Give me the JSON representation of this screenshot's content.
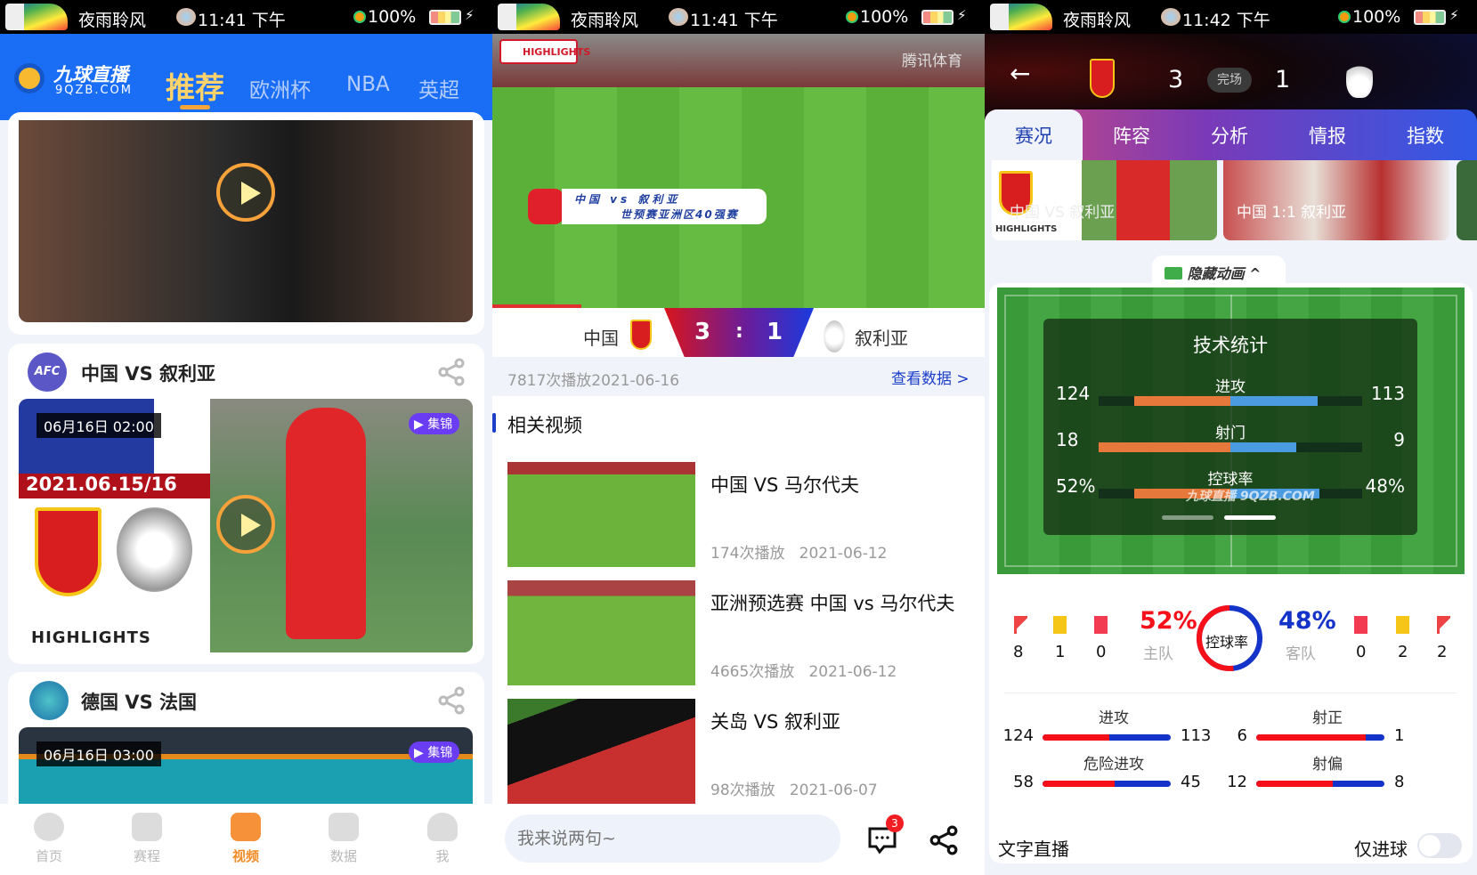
{
  "status_bars": [
    {
      "carrier": "夜雨聆风",
      "time": "11:41 下午",
      "battery": "100%"
    },
    {
      "carrier": "夜雨聆风",
      "time": "11:41 下午",
      "battery": "100%"
    },
    {
      "carrier": "夜雨聆风",
      "time": "11:42 下午",
      "battery": "100%"
    }
  ],
  "home": {
    "logo_text": "九球直播",
    "logo_sub": "9QZB.COM",
    "tabs": [
      "推荐",
      "欧洲杯",
      "NBA",
      "英超"
    ],
    "active_tab": "推荐",
    "cards": [
      {
        "title": "中国 VS 叙利亚",
        "league_icon": "afc-logo",
        "time": "06月16日 02:00",
        "badge": "集锦",
        "overlay_date": "2021.06.15/16",
        "overlay_label": "HIGHLIGHTS"
      },
      {
        "title": "德国 VS 法国",
        "league_icon": "euro-logo",
        "time": "06月16日 03:00",
        "badge": "集锦"
      }
    ],
    "nav": [
      {
        "label": "首页",
        "icon": "home-icon"
      },
      {
        "label": "赛程",
        "icon": "trophy-icon"
      },
      {
        "label": "视频",
        "icon": "video-icon",
        "active": true
      },
      {
        "label": "数据",
        "icon": "data-icon"
      },
      {
        "label": "我",
        "icon": "profile-icon"
      }
    ]
  },
  "video_page": {
    "player": {
      "badge": "HIGHLIGHTS",
      "caption_line1": "中国 vs 叙利亚",
      "caption_line2": "世预赛亚洲区40强赛",
      "watermark": "腾讯体育"
    },
    "home_team": "中国",
    "away_team": "叙利亚",
    "home_score": "3",
    "separator": ":",
    "away_score": "1",
    "info": "7817次播放2021-06-16",
    "view_data_link": "查看数据",
    "related_title": "相关视频",
    "related": [
      {
        "title": "中国 VS 马尔代夫",
        "plays": "174次播放",
        "date": "2021-06-12"
      },
      {
        "title": "亚洲预选赛 中国 vs 马尔代夫",
        "plays": "4665次播放",
        "date": "2021-06-12"
      },
      {
        "title": "关岛 VS 叙利亚",
        "plays": "98次播放",
        "date": "2021-06-07"
      }
    ],
    "comment_placeholder": "我来说两句~",
    "comment_count": "3"
  },
  "match_page": {
    "home_score": "3",
    "status": "完场",
    "away_score": "1",
    "tabs": [
      "赛况",
      "阵容",
      "分析",
      "情报",
      "指数"
    ],
    "active_tab": "赛况",
    "highlight_thumbs": [
      {
        "label": "HIGHLIGHTS",
        "caption": "中国 VS 叙利亚"
      },
      {
        "caption": "中国 1:1 叙利亚"
      }
    ],
    "hide_animation": "隐藏动画",
    "tech_stats": {
      "title": "技术统计",
      "rows": [
        {
          "label": "进攻",
          "home": "124",
          "away": "113",
          "home_val": 124,
          "away_val": 113
        },
        {
          "label": "射门",
          "home": "18",
          "away": "9",
          "home_val": 18,
          "away_val": 9
        },
        {
          "label": "控球率",
          "home": "52%",
          "away": "48%",
          "home_val": 52,
          "away_val": 48
        }
      ],
      "watermark": "九球直播 9QZB.COM"
    },
    "summary": {
      "home": {
        "corners": "8",
        "yellow": "1",
        "red": "0",
        "possession": "52%",
        "label": "主队"
      },
      "away": {
        "corners": "2",
        "yellow": "2",
        "red": "0",
        "possession": "48%",
        "label": "客队"
      },
      "center_label": "控球率",
      "possession_home_fraction": 0.52
    },
    "bars": [
      {
        "label": "进攻",
        "home": "124",
        "away": "113",
        "home_val": 124,
        "away_val": 113
      },
      {
        "label": "射正",
        "home": "6",
        "away": "1",
        "home_val": 6,
        "away_val": 1
      },
      {
        "label": "危险进攻",
        "home": "58",
        "away": "45",
        "home_val": 58,
        "away_val": 45
      },
      {
        "label": "射偏",
        "home": "12",
        "away": "8",
        "home_val": 12,
        "away_val": 8
      }
    ],
    "text_live": "文字直播",
    "goals_only": "仅进球",
    "goals_only_on": false
  },
  "colors": {
    "brand_blue": "#1a6ef5",
    "accent_orange": "#f6a53b",
    "home_red": "#f5101a",
    "away_blue": "#1433c9"
  }
}
